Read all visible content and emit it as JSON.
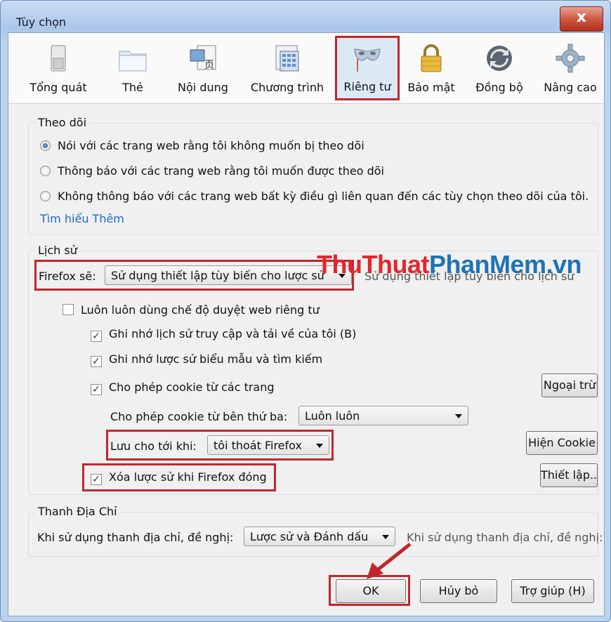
{
  "window": {
    "title": "Tùy chọn",
    "close_glyph": "x"
  },
  "toolbar": {
    "items": [
      {
        "label": "Tổng quát",
        "icon": "switch-icon"
      },
      {
        "label": "Thẻ",
        "icon": "folder-tabs-icon"
      },
      {
        "label": "Nội dung",
        "icon": "content-icon"
      },
      {
        "label": "Chương trình",
        "icon": "applications-icon"
      },
      {
        "label": "Riêng tư",
        "icon": "privacy-mask-icon",
        "selected": true
      },
      {
        "label": "Bảo mật",
        "icon": "padlock-icon"
      },
      {
        "label": "Đồng bộ",
        "icon": "sync-icon"
      },
      {
        "label": "Nâng cao",
        "icon": "gear-icon"
      }
    ]
  },
  "tracking": {
    "legend": "Theo dõi",
    "options": [
      {
        "label": "Nói với các trang web rằng tôi không muốn bị theo dõi",
        "checked": true
      },
      {
        "label": "Thông báo với các trang web rằng tôi muốn được theo dõi",
        "checked": false
      },
      {
        "label": "Không thông báo với các trang web bất kỳ điều gì liên quan đến các tùy chọn theo dõi của tôi.",
        "checked": false
      }
    ],
    "learn_more": "Tìm hiểu Thêm"
  },
  "history": {
    "legend": "Lịch sử",
    "firefox_will_label": "Firefox sẽ:",
    "firefox_will_value": "Sử dụng thiết lập tùy biến cho lược sử",
    "ghost_text": "Sử dụng thiết lập tùy biến cho lịch sử",
    "always_private": "Luôn luôn dùng chế độ duyệt web riêng tư",
    "remember_browsing": "Ghi nhớ lịch sử truy cập và tải về của tôi (B)",
    "remember_forms": "Ghi nhớ lược sử biểu mẫu và tìm kiếm",
    "accept_cookies": "Cho phép cookie từ các trang",
    "exceptions_button": "Ngoại trừ",
    "third_party_label": "Cho phép cookie từ bên thứ ba:",
    "third_party_value": "Luôn luôn",
    "keep_until_label": "Lưu cho tới khi:",
    "keep_until_value": "tôi thoát Firefox",
    "show_cookies_button": "Hiện Cookie",
    "clear_on_close": "Xóa lược sử khi Firefox đóng",
    "settings_button": "Thiết lập..."
  },
  "location_bar": {
    "legend": "Thanh Địa Chỉ",
    "label": "Khi sử dụng thanh địa chỉ, đề nghị:",
    "value": "Lược sử và Đánh dấu",
    "ghost_text": "Khi sử dụng thanh địa chỉ, đề nghị:"
  },
  "footer": {
    "ok": "OK",
    "cancel": "Hủy bỏ",
    "help": "Trợ giúp (H)"
  },
  "watermark": {
    "part1": "ThuThuat",
    "part2": "PhanMem",
    "part3": ".vn"
  },
  "colors": {
    "highlight": "#c0272d",
    "link": "#1a6cc7",
    "watermark_red": "#e3262c",
    "watermark_blue": "#1f73b7"
  }
}
